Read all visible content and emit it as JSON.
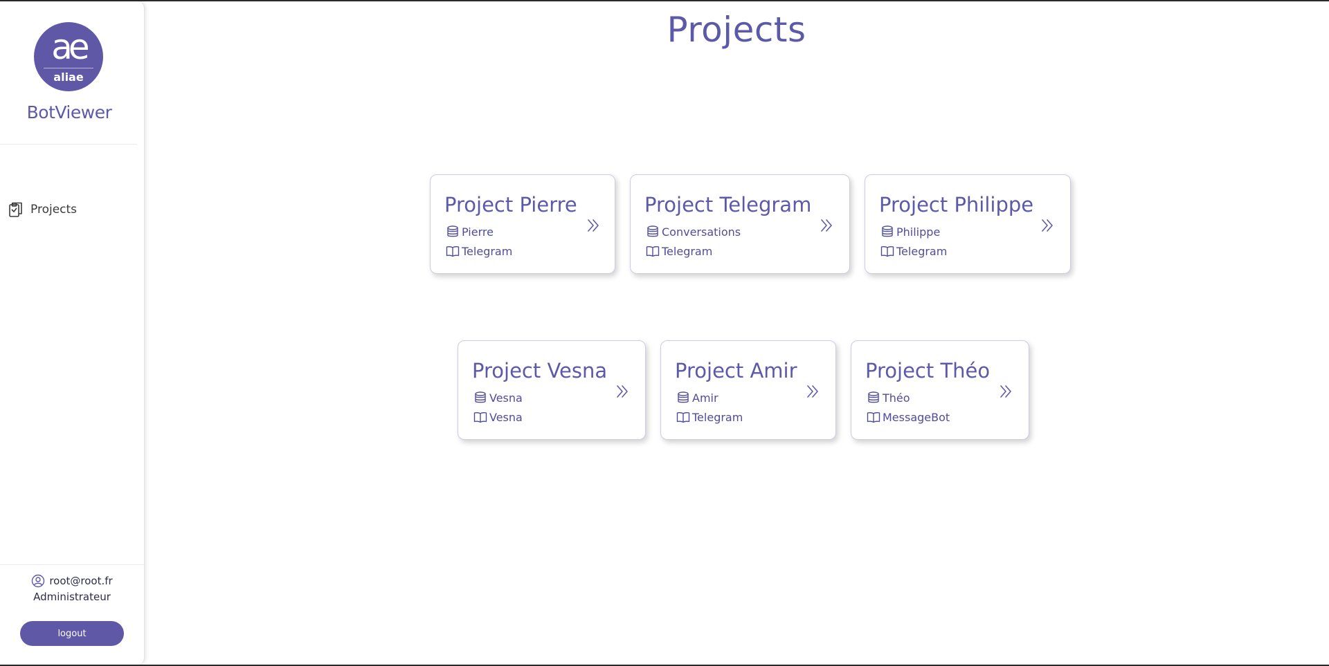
{
  "sidebar": {
    "logo_glyph": "ae",
    "logo_text": "aliae",
    "brand": "BotViewer",
    "nav": [
      {
        "label": "Projects",
        "icon": "clipboard-icon"
      }
    ],
    "user": {
      "email": "root@root.fr",
      "role": "Administrateur",
      "logout_label": "logout"
    }
  },
  "main": {
    "title": "Projects",
    "projects": [
      {
        "title": "Project Pierre",
        "database": "Pierre",
        "source": "Telegram"
      },
      {
        "title": "Project Telegram",
        "database": "Conversations",
        "source": "Telegram"
      },
      {
        "title": "Project Philippe",
        "database": "Philippe",
        "source": "Telegram"
      },
      {
        "title": "Project Vesna",
        "database": "Vesna",
        "source": "Vesna"
      },
      {
        "title": "Project Amir",
        "database": "Amir",
        "source": "Telegram"
      },
      {
        "title": "Project Théo",
        "database": "Théo",
        "source": "MessageBot"
      }
    ]
  },
  "colors": {
    "accent": "#5f58a6",
    "text_accent": "#5c5aa8",
    "card_border": "#cfcbe6"
  }
}
